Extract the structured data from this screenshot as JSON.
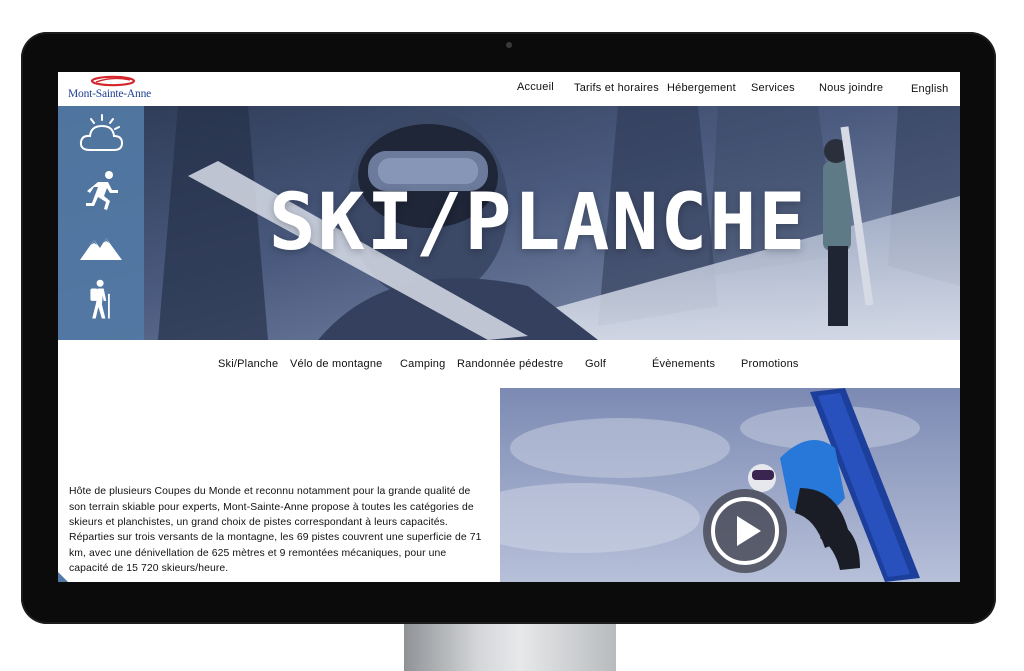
{
  "site": {
    "logo_text": "Mont-Sainte-Anne"
  },
  "nav": {
    "items": [
      {
        "label": "Accueil"
      },
      {
        "label": "Tarifs et horaires"
      },
      {
        "label": "Hébergement"
      },
      {
        "label": "Services"
      },
      {
        "label": "Nous joindre"
      },
      {
        "label": "English"
      }
    ]
  },
  "hero": {
    "title": "SKI/PLANCHE",
    "side_icons": [
      "weather-icon",
      "running-icon",
      "mountain-icon",
      "hiker-icon"
    ]
  },
  "subnav": {
    "items": [
      {
        "label": "Ski/Planche"
      },
      {
        "label": "Vélo de montagne"
      },
      {
        "label": "Camping"
      },
      {
        "label": "Randonnée pédestre"
      },
      {
        "label": "Golf"
      },
      {
        "label": "Évènements"
      },
      {
        "label": "Promotions"
      }
    ]
  },
  "content": {
    "intro": "Hôte de plusieurs Coupes du Monde et reconnu notamment pour la grande qualité de son terrain skiable pour experts, Mont-Sainte-Anne propose à toutes les catégories de skieurs et planchistes, un grand choix de pistes correspondant à leurs capacités. Réparties sur trois versants de la montagne, les 69 pistes couvrent une superficie de 71 km, avec une dénivellation de 625 mètres et 9 remontées mécaniques, pour une capacité de 15 720 skieurs/heure.",
    "video_icon": "play-icon"
  },
  "colors": {
    "brand_blue": "#1f3f8f",
    "logo_red": "#d4262b",
    "rail_blue": "#5279a5",
    "bezel": "#0b0b0c"
  }
}
